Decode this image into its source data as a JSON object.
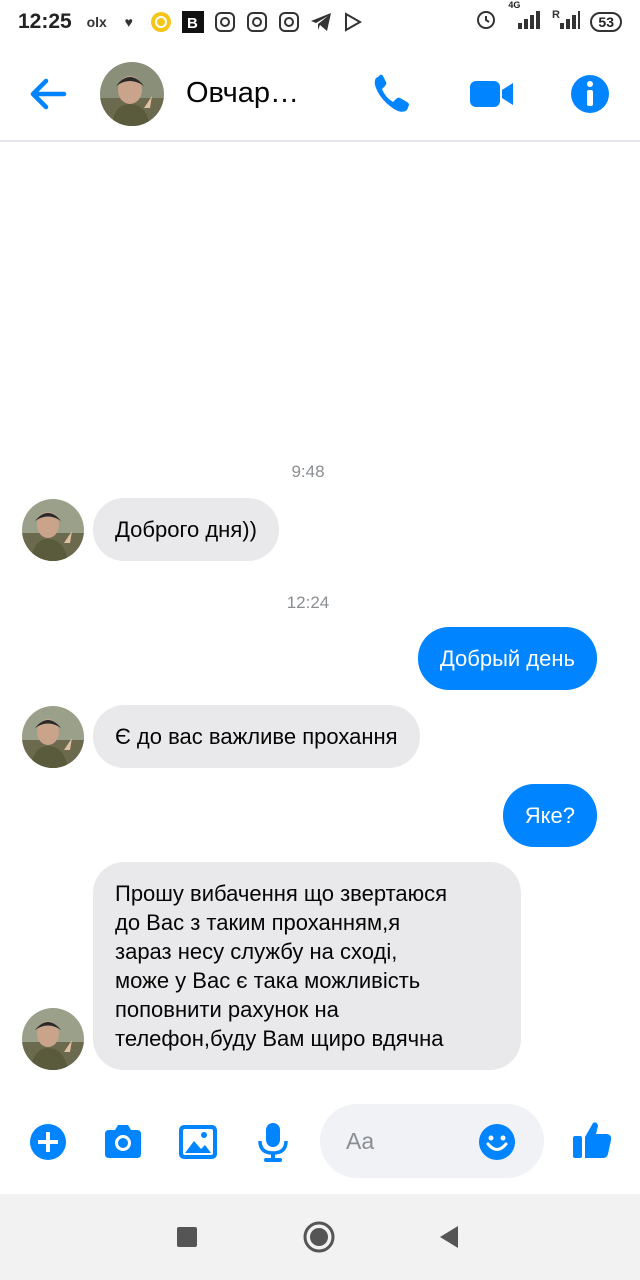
{
  "status_bar": {
    "time": "12:25",
    "battery": "53",
    "network_label": "4G"
  },
  "header": {
    "contact_name": "Овчар…"
  },
  "messages": {
    "ts1": "9:48",
    "m1": "Доброго дня))",
    "ts2": "12:24",
    "m2": "Добрый день",
    "m3": "Є до вас важливе прохання",
    "m4": "Яке?",
    "m5_lines": [
      "Прошу вибачення що звертаюся",
      "до Вас з таким проханням,я",
      "зараз несу службу на сході,",
      "може у Вас є така можливість",
      "поповнити рахунок на",
      "телефон,буду Вам щиро вдячна"
    ]
  },
  "composer": {
    "placeholder": "Aa"
  },
  "colors": {
    "accent": "#0084ff",
    "incoming_bubble": "#e9e9eb",
    "timestamp": "#8a8d91"
  },
  "icons": [
    "back-arrow-icon",
    "phone-icon",
    "video-icon",
    "info-icon",
    "plus-icon",
    "camera-icon",
    "gallery-icon",
    "mic-icon",
    "emoji-icon",
    "like-icon",
    "nav-square-icon",
    "nav-circle-icon",
    "nav-triangle-icon"
  ]
}
